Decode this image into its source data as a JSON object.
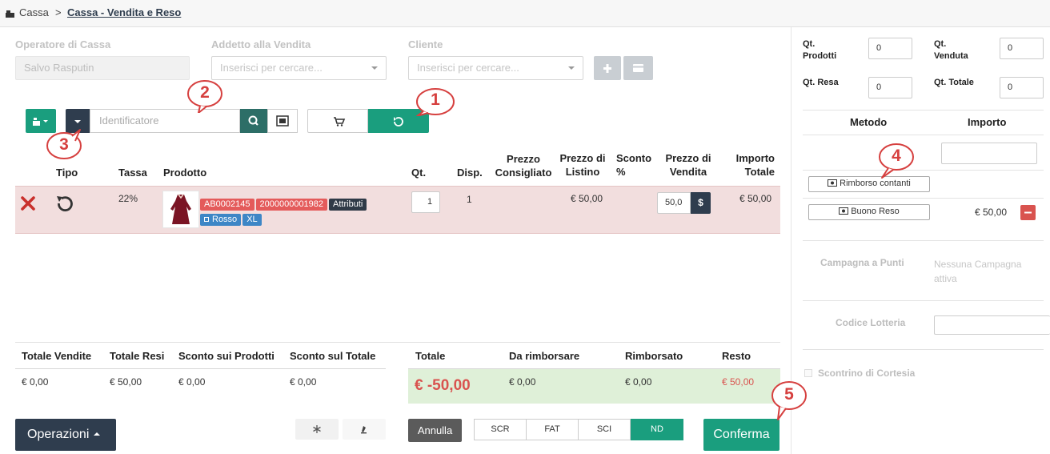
{
  "breadcrumb": {
    "root": "Cassa",
    "separator": ">",
    "current": "Cassa - Vendita e Reso"
  },
  "form": {
    "operator_label": "Operatore di Cassa",
    "operator_value": "Salvo Rasputin",
    "seller_label": "Addetto alla Vendita",
    "seller_placeholder": "Inserisci per cercare...",
    "customer_label": "Cliente",
    "customer_placeholder": "Inserisci per cercare..."
  },
  "scan": {
    "identifier_placeholder": "Identificatore"
  },
  "callouts": [
    "1",
    "2",
    "3",
    "4",
    "5"
  ],
  "table": {
    "headers": {
      "tipo": "Tipo",
      "tassa": "Tassa",
      "prodotto": "Prodotto",
      "qt": "Qt.",
      "disp": "Disp.",
      "prezzo_consigliato": "Prezzo Consigliato",
      "prezzo_listino": "Prezzo di Listino",
      "sconto": "Sconto %",
      "prezzo_vendita": "Prezzo di Vendita",
      "importo_totale": "Importo Totale"
    },
    "rows": [
      {
        "tassa": "22%",
        "code": "AB0002145",
        "barcode": "2000000001982",
        "attributes_label": "Attributi",
        "color": "Rosso",
        "size": "XL",
        "qt": "1",
        "disp": "1",
        "prezzo_listino": "€ 50,00",
        "prezzo_vendita": "50,0",
        "currency_button": "$",
        "importo_totale": "€ 50,00"
      }
    ]
  },
  "totals": {
    "totale_vendite_label": "Totale Vendite",
    "totale_vendite": "€ 0,00",
    "totale_resi_label": "Totale Resi",
    "totale_resi": "€ 50,00",
    "sconto_prodotti_label": "Sconto sui Prodotti",
    "sconto_prodotti": "€ 0,00",
    "sconto_totale_label": "Sconto sul Totale",
    "sconto_totale": "€ 0,00",
    "totale_label": "Totale",
    "totale": "€ -50,00",
    "da_rimborsare_label": "Da rimborsare",
    "da_rimborsare": "€ 0,00",
    "rimborsato_label": "Rimborsato",
    "rimborsato": "€ 0,00",
    "resto_label": "Resto",
    "resto": "€ 50,00"
  },
  "footer": {
    "operazioni": "Operazioni",
    "annulla": "Annulla",
    "doc_types": [
      "SCR",
      "FAT",
      "SCI",
      "ND"
    ],
    "doc_selected": "ND",
    "conferma": "Conferma"
  },
  "right": {
    "qt_prodotti_label": "Qt. Prodotti",
    "qt_prodotti": "0",
    "qt_venduta_label": "Qt. Venduta",
    "qt_venduta": "0",
    "qt_resa_label": "Qt. Resa",
    "qt_resa": "0",
    "qt_totale_label": "Qt. Totale",
    "qt_totale": "0",
    "metodo_label": "Metodo",
    "importo_label": "Importo",
    "rimborso_contanti": "Rimborso contanti",
    "buono_reso": "Buono Reso",
    "buono_reso_amount": "€ 50,00",
    "campagna_label": "Campagna a Punti",
    "campagna_value": "Nessuna Campagna attiva",
    "lotteria_label": "Codice Lotteria",
    "scontrino_label": "Scontrino di Cortesia"
  },
  "colors": {
    "teal": "#1a9e7e",
    "navy": "#2f3d4e",
    "row_bg": "#f2dede",
    "green_bg": "#dff0d8",
    "red": "#d9534f"
  }
}
